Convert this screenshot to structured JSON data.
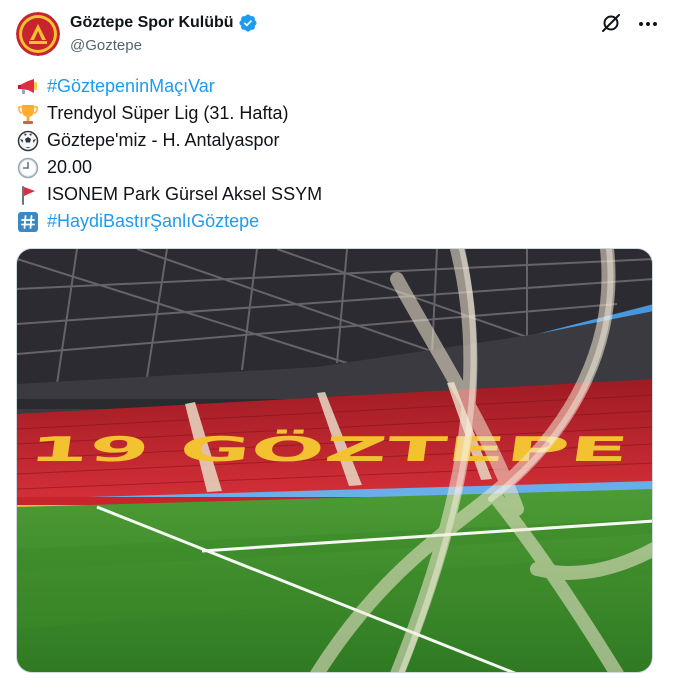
{
  "author": {
    "display_name": "Göztepe Spor Kulübü",
    "handle": "@Goztepe",
    "verified": true,
    "avatar_icon": "goztepe-logo-icon"
  },
  "actions": {
    "grok_icon": "grok-icon",
    "more_icon": "more-options-icon"
  },
  "tweet": {
    "lines": [
      {
        "emoji": "megaphone-icon",
        "text": "#GöztepeninMaçıVar",
        "hashtag": true
      },
      {
        "emoji": "trophy-icon",
        "text": "Trendyol Süper Lig (31. Hafta)",
        "hashtag": false
      },
      {
        "emoji": "soccer-ball-icon",
        "text": "Göztepe'miz - H. Antalyaspor",
        "hashtag": false
      },
      {
        "emoji": "clock-icon",
        "text": "20.00",
        "hashtag": false
      },
      {
        "emoji": "red-flag-icon",
        "text": "ISONEM Park Gürsel Aksel SSYM",
        "hashtag": false
      },
      {
        "emoji": "hash-keycap-icon",
        "text": "#HaydiBastırŞanlıGöztepe",
        "hashtag": true
      }
    ]
  },
  "media": {
    "description_icon": "stadium-photo",
    "stand_letters": "19 GÖZTEPE",
    "colors": {
      "seats_red": "#c8242e",
      "seats_yellow": "#f2c230",
      "pitch_green": "#3e8f2c",
      "sky": "#5aa7e6"
    }
  },
  "colors": {
    "text": "#0f1419",
    "muted": "#536471",
    "link": "#1d9bf0",
    "verified": "#1d9bf0"
  }
}
